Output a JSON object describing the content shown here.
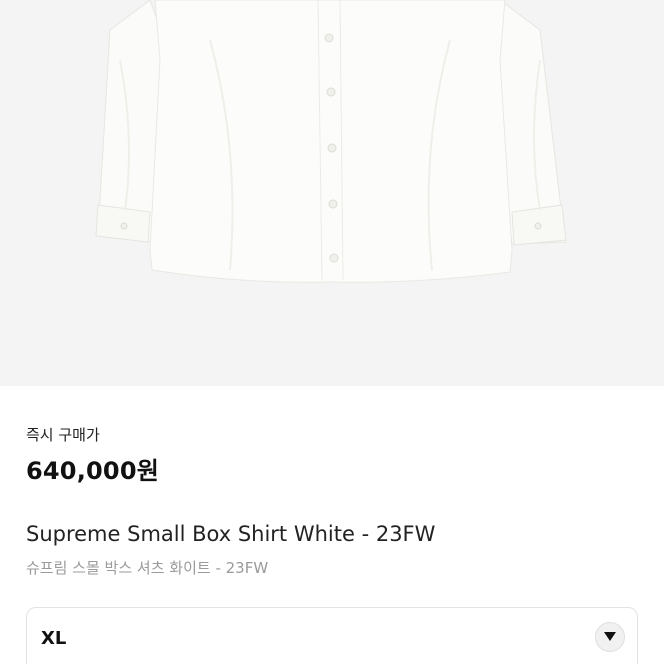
{
  "product": {
    "price_label": "즉시 구매가",
    "price": "640,000원",
    "title": "Supreme Small Box Shirt White - 23FW",
    "subtitle": "슈프림 스몰 박스 셔츠 화이트 - 23FW"
  },
  "size_select": {
    "value": "XL",
    "icon": "chevron-down-icon"
  },
  "colors": {
    "image_background": "#f4f4f4",
    "text_primary": "#111111",
    "text_secondary": "#9a9a9a"
  }
}
